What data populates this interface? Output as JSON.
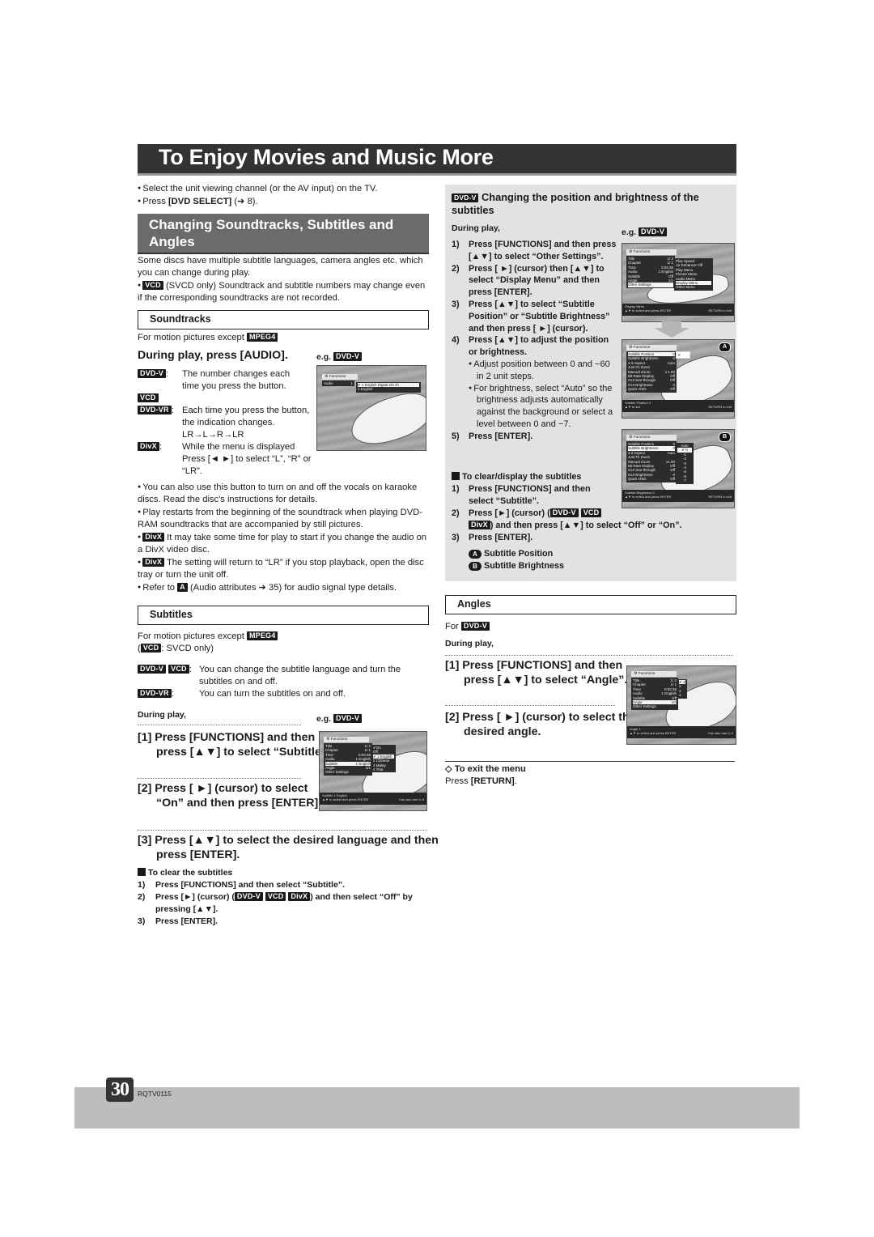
{
  "page": {
    "title": "To Enjoy Movies and Music More",
    "page_number": "30",
    "doc_code": "RQTV0115"
  },
  "intro": {
    "bullets": [
      "Select the unit viewing channel (or the AV input) on the TV.",
      "Press [DVD SELECT] (➔ 8)."
    ]
  },
  "section": {
    "heading": "Changing Soundtracks, Subtitles and Angles",
    "desc": "Some discs have multiple subtitle languages, camera angles etc. which you can change during play.",
    "vcd_note_badge": "VCD",
    "vcd_note": "(SVCD only) Soundtrack and subtitle numbers may change even if the corresponding soundtracks are not recorded."
  },
  "soundtracks": {
    "heading": "Soundtracks",
    "except_text": "For motion pictures except",
    "except_badge": "MPEG4",
    "instruction": "During play, press [AUDIO].",
    "eg_label": "e.g.",
    "eg_badge": "DVD-V",
    "items": [
      {
        "badge": "DVD-V",
        "text": "The number changes each time you press the button."
      },
      {
        "badge": "VCD",
        "text": ""
      },
      {
        "badge": "DVD-VR",
        "text": "Each time you press the button, the indication changes."
      },
      {
        "badge": "",
        "text": "LR→L→R→LR"
      },
      {
        "badge": "DivX",
        "text": "While the menu is displayed Press [◄ ►] to select “L”, “R” or “LR”."
      }
    ],
    "notes": [
      {
        "badge": "",
        "text": "You can also use this button to turn on and off the vocals on karaoke discs. Read the disc's instructions for details."
      },
      {
        "badge": "",
        "text": "Play restarts from the beginning of the soundtrack when playing DVD-RAM soundtracks that are accompanied by still pictures."
      },
      {
        "badge": "DivX",
        "text": "It may take some time for play to start if you change the audio on a DivX video disc."
      },
      {
        "badge": "DivX",
        "text": "The setting will return to “LR” if you stop playback, open the disc tray or turn the unit off."
      },
      {
        "badge": "A",
        "prefix": "Refer to",
        "text": "(Audio attributes ➔ 35) for audio signal type details."
      }
    ],
    "screen": {
      "functions": "Functions",
      "row_label": "Audio",
      "row_value": "1",
      "options": [
        "✔ 1 English  Digital 2/0 ch",
        "2 English"
      ]
    }
  },
  "subtitles": {
    "heading": "Subtitles",
    "except_text": "For motion pictures except",
    "except_badge": "MPEG4",
    "vcd_paren_badge": "VCD",
    "vcd_paren_text": ": SVCD only)",
    "items": [
      {
        "badges": [
          "DVD-V",
          "VCD"
        ],
        "text": "You can change the subtitle language and turn the subtitles on and off."
      },
      {
        "badges": [
          "DVD-VR"
        ],
        "text": "You can turn the subtitles on and off."
      }
    ],
    "during_play": "During play,",
    "eg_label": "e.g.",
    "eg_badge": "DVD-V",
    "steps": [
      "[1] Press [FUNCTIONS] and then press [▲▼] to select “Subtitle”.",
      "[2] Press [ ►] (cursor) to select “On” and then press [ENTER].",
      "[3] Press [▲▼] to select the desired language and then press [ENTER]."
    ],
    "clear": {
      "heading": "To clear the subtitles",
      "steps": [
        {
          "num": "1)",
          "text": "Press [FUNCTIONS] and then select “Subtitle”."
        },
        {
          "num": "2)",
          "text_a": "Press [►] (cursor) (",
          "badges": [
            "DVD-V",
            "VCD",
            "DivX"
          ],
          "text_b": ") and then select “Off” by pressing [▲▼]."
        },
        {
          "num": "3)",
          "text": "Press [ENTER]."
        }
      ]
    },
    "screen": {
      "functions": "Functions",
      "rows": [
        {
          "label": "Title",
          "value": "1/ 2"
        },
        {
          "label": "Chapter",
          "value": "1/ 1"
        },
        {
          "label": "Time",
          "value": "0:02:36"
        },
        {
          "label": "Audio",
          "value": "1 English"
        },
        {
          "label": "Subtitle",
          "value": "1 English"
        },
        {
          "label": "Angle",
          "value": "1/1"
        },
        {
          "label": "Other Settings",
          "value": ""
        }
      ],
      "options": [
        "✔On",
        "Off",
        "✔ 1 English",
        "2 Chinese",
        "3 Malay",
        "4 Thai"
      ],
      "status": "Subtitle 1 English",
      "hint": "▲▼ to select and press ENTER",
      "hint_right": "Can also use 0–9"
    }
  },
  "position_brightness": {
    "badge": "DVD-V",
    "heading": "Changing the position and brightness of the subtitles",
    "during_play": "During play,",
    "eg_label": "e.g.",
    "eg_badge": "DVD-V",
    "steps": [
      {
        "num": "1)",
        "text": "Press [FUNCTIONS] and then press [▲▼] to select “Other Settings”."
      },
      {
        "num": "2)",
        "text": "Press [ ►] (cursor) then [▲▼] to select “Display Menu” and then press [ENTER]."
      },
      {
        "num": "3)",
        "text": "Press [▲▼] to select “Subtitle Position” or “Subtitle Brightness” and then press [ ►] (cursor)."
      },
      {
        "num": "4)",
        "text": "Press [▲▼] to adjust the position or brightness."
      },
      {
        "num": "5)",
        "text": "Press [ENTER]."
      }
    ],
    "step4_bullets": [
      "Adjust position between 0 and −60 in 2 unit steps.",
      "For brightness, select “Auto” so the brightness adjusts automatically against the background or select a level between 0 and −7."
    ],
    "clear": {
      "heading": "To clear/display the subtitles",
      "step1": "Press [FUNCTIONS] and then select “Subtitle”.",
      "step2_a": "Press [►] (cursor) (",
      "step2_badges": [
        "DVD-V",
        "VCD",
        "DivX"
      ],
      "step2_b": ") and then press [▲▼] to select “Off” or “On”.",
      "step3": "Press [ENTER].",
      "nums": [
        "1)",
        "2)",
        "3)"
      ]
    },
    "legend": [
      {
        "key": "A",
        "label": "Subtitle Position"
      },
      {
        "key": "B",
        "label": "Subtitle Brightness"
      }
    ],
    "screen1": {
      "functions": "Functions",
      "rows": [
        {
          "label": "Title",
          "value": "1/ 2"
        },
        {
          "label": "Chapter",
          "value": "1/ 1"
        },
        {
          "label": "Time",
          "value": "0:02:36"
        },
        {
          "label": "Audio",
          "value": "1 English"
        },
        {
          "label": "Subtitle",
          "value": "Off"
        },
        {
          "label": "Angle",
          "value": "1/1"
        },
        {
          "label": "Other Settings",
          "value": ""
        }
      ],
      "submenu": [
        "Play Speed",
        "Air Enhancer  Off",
        "Play Menu",
        "Picture Menu",
        "Audio Menu",
        "Display Menu",
        "Other Menu"
      ],
      "status": "Display Menu",
      "hint": "▲▼ to select and press ENTER",
      "hint_right": "RETURN to exit"
    },
    "screen2": {
      "corner": "A",
      "functions": "Functions",
      "rows": [
        {
          "label": "Subtitle Position",
          "value": "0"
        },
        {
          "label": "Subtitle Brightness",
          "value": "0"
        },
        {
          "label": "4:3 Aspect",
          "value": "Auto"
        },
        {
          "label": "Just Fit Zoom",
          "value": ""
        },
        {
          "label": "Manual Zoom",
          "value": "x 1.00"
        },
        {
          "label": "Bit Rate Display",
          "value": "Off"
        },
        {
          "label": "GUI See-through",
          "value": "Off"
        },
        {
          "label": "GUI Brightness",
          "value": "0"
        },
        {
          "label": "Quick OSD",
          "value": "Off"
        }
      ],
      "slider_value": "0",
      "status": "Subtitle Position  0",
      "hint": "▲▼ to set",
      "hint_right": "RETURN to exit"
    },
    "screen3": {
      "corner": "B",
      "functions": "Functions",
      "rows": [
        {
          "label": "Subtitle Position",
          "value": "0"
        },
        {
          "label": "Subtitle Brightness",
          "value": "0"
        },
        {
          "label": "4:3 Aspect",
          "value": "Auto"
        },
        {
          "label": "Just Fit Zoom",
          "value": ""
        },
        {
          "label": "Manual Zoom",
          "value": "x1.00"
        },
        {
          "label": "Bit Rate Display",
          "value": "Off"
        },
        {
          "label": "GUI See-through",
          "value": "Off"
        },
        {
          "label": "GUI Brightness",
          "value": "0"
        },
        {
          "label": "Quick OSD",
          "value": "Off"
        }
      ],
      "options": [
        "Auto",
        "✔ 0",
        "-1",
        "-2",
        "-3",
        "-4",
        "-5",
        "-6",
        "-7"
      ],
      "status": "Subtitle Brightness  0",
      "hint": "▲▼ to select and press ENTER",
      "hint_right": "RETURN to exit"
    }
  },
  "angles": {
    "heading": "Angles",
    "for_text": "For",
    "for_badge": "DVD-V",
    "during_play": "During play,",
    "steps": [
      "[1] Press [FUNCTIONS] and then press [▲▼] to select “Angle”.",
      "[2] Press [ ►] (cursor) to select the desired angle."
    ],
    "exit_heading": "To exit the menu",
    "exit_text_a": "Press ",
    "exit_text_b": "[RETURN]",
    "exit_text_c": ".",
    "screen": {
      "functions": "Functions",
      "rows": [
        {
          "label": "Title",
          "value": "1/ 2"
        },
        {
          "label": "Chapter",
          "value": "1/ 1"
        },
        {
          "label": "Time",
          "value": "0:02:36"
        },
        {
          "label": "Audio",
          "value": "1 English"
        },
        {
          "label": "Subtitle",
          "value": "Off"
        },
        {
          "label": "Angle",
          "value": "1/4"
        },
        {
          "label": "Other Settings",
          "value": ""
        }
      ],
      "options": [
        "✔ 1",
        "2",
        "3",
        "4"
      ],
      "status": "Angle 1",
      "hint": "▲▼ to select and press ENTER",
      "hint_right": "Can also use 0–9"
    }
  }
}
